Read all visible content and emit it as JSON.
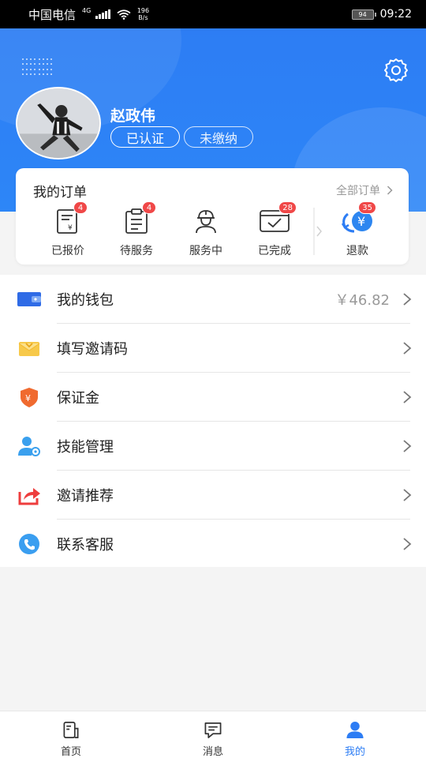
{
  "status_bar": {
    "carrier": "中国电信",
    "network": "4G",
    "speed_value": "196",
    "speed_unit": "B/s",
    "battery": "94",
    "time": "09:22"
  },
  "profile": {
    "name": "赵政伟",
    "verified_label": "已认证",
    "unpaid_label": "未缴纳"
  },
  "orders": {
    "title": "我的订单",
    "all_label": "全部订单",
    "items": [
      {
        "label": "已报价",
        "count": "4",
        "icon": "quoted-order-icon"
      },
      {
        "label": "待服务",
        "count": "4",
        "icon": "pending-service-icon"
      },
      {
        "label": "服务中",
        "count": "",
        "icon": "in-service-worker-icon"
      },
      {
        "label": "已完成",
        "count": "28",
        "icon": "completed-order-icon"
      },
      {
        "label": "退款",
        "count": "35",
        "icon": "refund-icon"
      }
    ]
  },
  "menu": [
    {
      "label": "我的钱包",
      "value": "￥46.82",
      "icon": "wallet-icon",
      "color": "#2f6be6"
    },
    {
      "label": "填写邀请码",
      "value": "",
      "icon": "invite-code-envelope-icon",
      "color": "#f5c23a"
    },
    {
      "label": "保证金",
      "value": "",
      "icon": "deposit-shield-icon",
      "color": "#f06a2f"
    },
    {
      "label": "技能管理",
      "value": "",
      "icon": "skill-management-icon",
      "color": "#3aa0ee"
    },
    {
      "label": "邀请推荐",
      "value": "",
      "icon": "share-recommend-icon",
      "color": "#ee3d3d"
    },
    {
      "label": "联系客服",
      "value": "",
      "icon": "customer-service-phone-icon",
      "color": "#3a9ef0"
    }
  ],
  "bottom_nav": [
    {
      "label": "首页",
      "icon": "home-icon",
      "active": false
    },
    {
      "label": "消息",
      "icon": "message-icon",
      "active": false
    },
    {
      "label": "我的",
      "icon": "profile-icon",
      "active": true
    }
  ],
  "colors": {
    "primary": "#2d7df4",
    "badge": "#f04848"
  }
}
